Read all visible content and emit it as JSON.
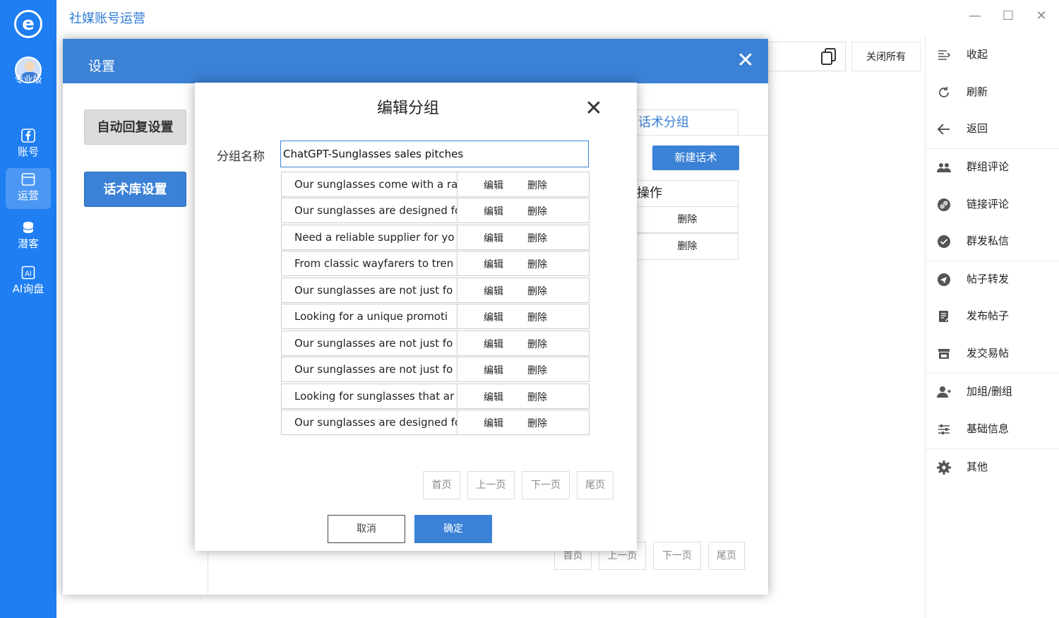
{
  "app": {
    "title": "社媒账号运营",
    "logo": "e",
    "badge": "专业版"
  },
  "colors": {
    "primary": "#3b82d6",
    "nav_bg": "#1e7ef2"
  },
  "nav": [
    {
      "label": "账号",
      "icon": "facebook-icon"
    },
    {
      "label": "运营",
      "icon": "window-icon",
      "active": true
    },
    {
      "label": "潜客",
      "icon": "database-icon"
    },
    {
      "label": "AI询盘",
      "icon": "ai-icon"
    }
  ],
  "toolbar": {
    "close_all": "关闭所有"
  },
  "right_panel": [
    {
      "label": "收起",
      "icon": "collapse-icon"
    },
    {
      "label": "刷新",
      "icon": "refresh-icon"
    },
    {
      "label": "返回",
      "icon": "arrow-left-icon"
    },
    {
      "label": "群组评论",
      "icon": "group-icon"
    },
    {
      "label": "链接评论",
      "icon": "link-icon"
    },
    {
      "label": "群发私信",
      "icon": "check-circle-icon"
    },
    {
      "label": "帖子转发",
      "icon": "send-icon"
    },
    {
      "label": "发布帖子",
      "icon": "edit-note-icon"
    },
    {
      "label": "发交易帖",
      "icon": "store-icon"
    },
    {
      "label": "加组/删组",
      "icon": "user-add-icon"
    },
    {
      "label": "基础信息",
      "icon": "sliders-icon"
    },
    {
      "label": "其他",
      "icon": "gear-icon"
    }
  ],
  "settings": {
    "title": "设置",
    "auto_reply": "自动回复设置",
    "library": "话术库设置",
    "bg": {
      "tab": "话术分组",
      "new_button": "新建话术",
      "ops_header": "操作",
      "rows": [
        "删除",
        "删除"
      ],
      "pagination": [
        "首页",
        "上一页",
        "下一页",
        "尾页"
      ]
    }
  },
  "edit_group": {
    "title": "编辑分组",
    "name_label": "分组名称",
    "name_value": "ChatGPT-Sunglasses sales pitches",
    "edit_label": "编辑",
    "delete_label": "删除",
    "rows": [
      "Our sunglasses come with a ra",
      "Our sunglasses are designed fo",
      "Need a reliable supplier for yo",
      "From classic wayfarers to tren",
      "Our sunglasses are not just fo",
      "Looking for a unique promoti",
      "Our sunglasses are not just fo",
      "Our sunglasses are not just fo",
      "Looking for sunglasses that ar",
      "Our sunglasses are designed fo"
    ],
    "pagination": [
      "首页",
      "上一页",
      "下一页",
      "尾页"
    ],
    "cancel": "取消",
    "ok": "确定"
  }
}
